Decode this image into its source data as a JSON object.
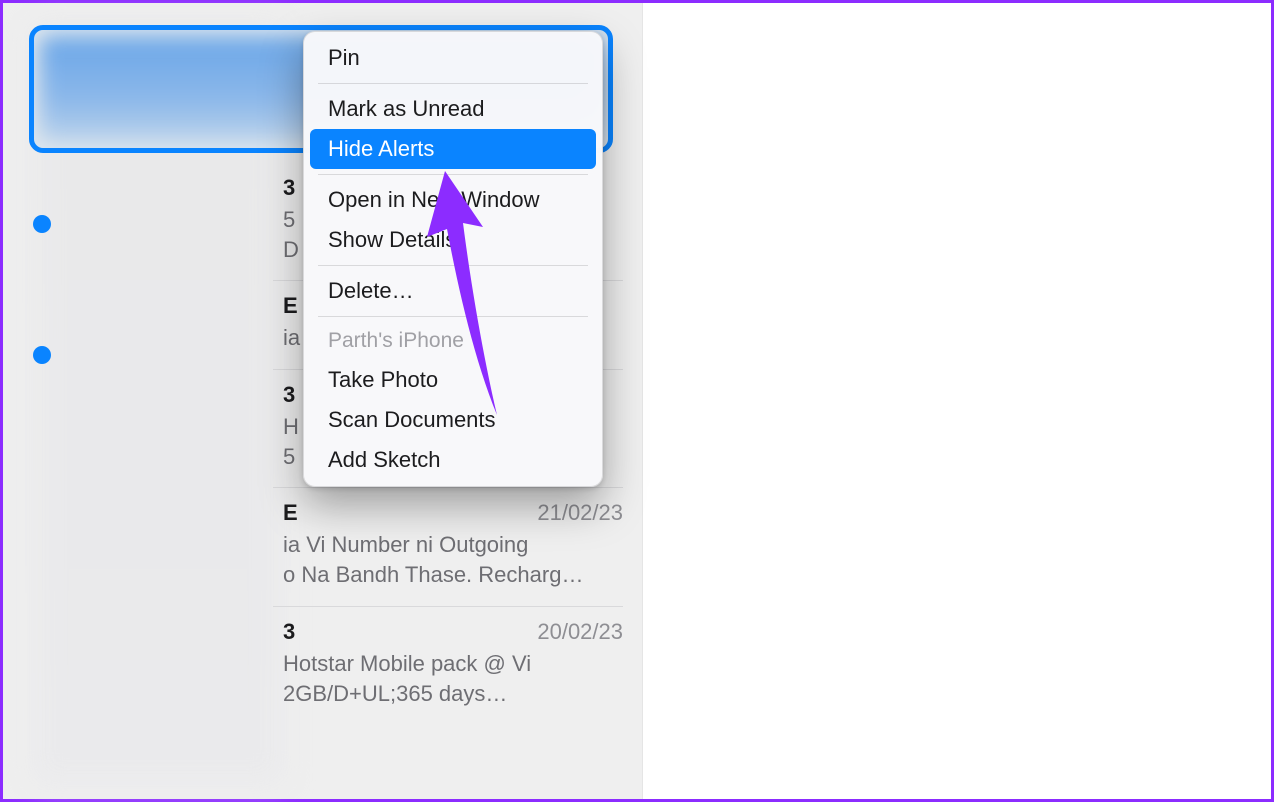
{
  "contextMenu": {
    "items": {
      "pin": "Pin",
      "markUnread": "Mark as Unread",
      "hideAlerts": "Hide Alerts",
      "openNewWindow": "Open in New Window",
      "showDetails": "Show Details",
      "delete": "Delete…",
      "deviceLabel": "Parth's iPhone",
      "takePhoto": "Take Photo",
      "scanDocs": "Scan Documents",
      "addSketch": "Add Sketch"
    }
  },
  "conversations": [
    {
      "nameStub": "3",
      "date": "",
      "preview": "5\nD"
    },
    {
      "nameStub": "E",
      "date": "",
      "preview": "ia"
    },
    {
      "nameStub": "3",
      "date": "",
      "preview": "H\n5"
    },
    {
      "nameStub": "E",
      "date": "21/02/23",
      "preview": "ia Vi Number ni Outgoing\no Na Bandh Thase. Recharg…"
    },
    {
      "nameStub": "3",
      "date": "20/02/23",
      "preview": "Hotstar Mobile pack @ Vi\n2GB/D+UL;365 days…"
    }
  ]
}
